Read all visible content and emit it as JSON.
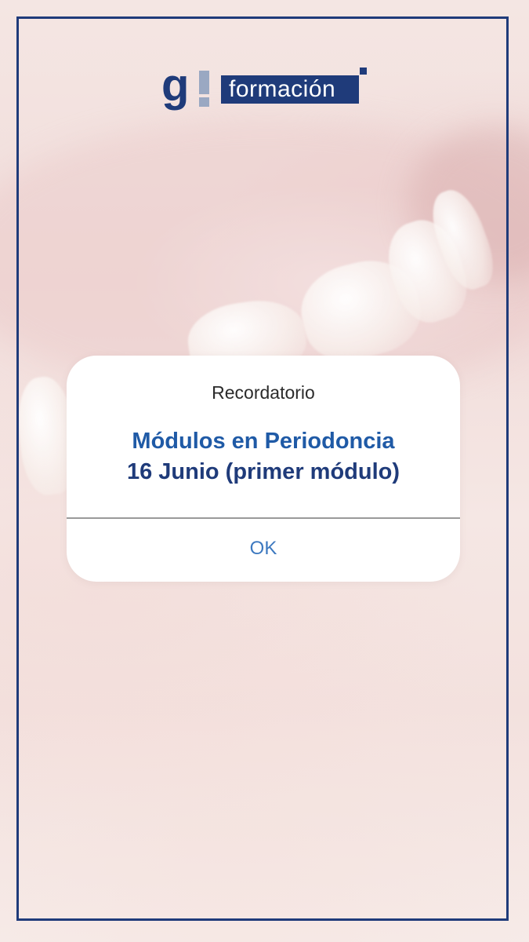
{
  "brand": {
    "mark": "g",
    "name": "formación",
    "color": "#1f3b7a",
    "accent_color": "#9aa8c2"
  },
  "dialog": {
    "title": "Recordatorio",
    "headline": "Módulos en Periodoncia",
    "subheadline": "16 Junio (primer módulo)",
    "ok_label": "OK",
    "headline_color": "#1f5aa6",
    "subheadline_color": "#1f3b7a",
    "button_color": "#3d79c0"
  },
  "frame": {
    "color": "#1f3b7a"
  }
}
